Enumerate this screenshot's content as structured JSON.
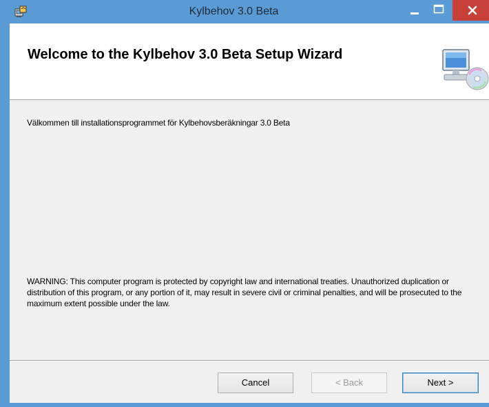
{
  "window": {
    "title": "Kylbehov 3.0 Beta",
    "colors": {
      "titlebar": "#5b9bd5",
      "close": "#c7403a",
      "client": "#f0f0f0"
    }
  },
  "title_controls": {
    "minimize_icon": "minimize-icon",
    "maximize_icon": "maximize-icon",
    "close_icon": "close-icon"
  },
  "banner": {
    "title": "Welcome to the Kylbehov 3.0 Beta Setup Wizard",
    "icon": "computer-cd-icon"
  },
  "body": {
    "welcome_text": "Välkommen till installationsprogrammet för Kylbehovsberäkningar 3.0 Beta",
    "warning_text": "WARNING: This computer program is protected by copyright law and international treaties. Unauthorized duplication or distribution of this program, or any portion of it, may result in severe civil or criminal penalties, and will be prosecuted to the maximum extent possible under the law."
  },
  "buttons": {
    "cancel": "Cancel",
    "back": "< Back",
    "next": "Next >"
  }
}
